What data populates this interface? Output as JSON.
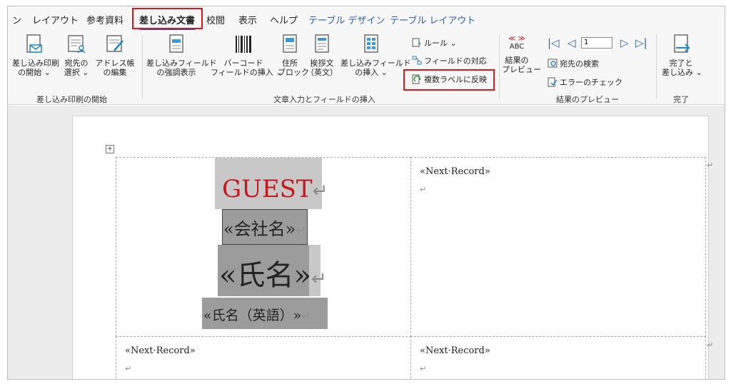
{
  "tabs": [
    {
      "label": "ン"
    },
    {
      "label": "レイアウト"
    },
    {
      "label": "参考資料"
    },
    {
      "label": "差し込み文書"
    },
    {
      "label": "校閲"
    },
    {
      "label": "表示"
    },
    {
      "label": "ヘルプ"
    },
    {
      "label": "テーブル デザイン"
    },
    {
      "label": "テーブル レイアウト"
    }
  ],
  "ribbon": {
    "start": {
      "merge_start": {
        "line1": "差し込み印刷",
        "line2": "の開始 ⌄"
      },
      "recipients": {
        "line1": "宛先の",
        "line2": "選択 ⌄"
      },
      "address_edit": {
        "line1": "アドレス帳",
        "line2": "の編集"
      },
      "group_label": "差し込み印刷の開始"
    },
    "insert": {
      "highlight": {
        "line1": "差し込みフィールド",
        "line2": "の強調表示"
      },
      "barcode": {
        "line1": "バーコード",
        "line2": "フィールドの挿入 ⌄"
      },
      "address_block": {
        "line1": "住所",
        "line2": "ブロック"
      },
      "greeting": {
        "line1": "挨拶文",
        "line2": "（英文）"
      },
      "merge_field": {
        "line1": "差し込みフィールド",
        "line2": "の挿入 ⌄"
      },
      "rules": "ルール ⌄",
      "match_fields": "フィールドの対応",
      "update_labels": "複数ラベルに反映",
      "group_label": "文章入力とフィールドの挿入"
    },
    "preview": {
      "abc_top": "≪ ≫",
      "abc_bottom": "ABC",
      "preview_results": {
        "line1": "結果の",
        "line2": "プレビュー"
      },
      "record_number": "1",
      "find_recipient": "宛先の検索",
      "check_errors": "エラーのチェック",
      "group_label": "結果のプレビュー"
    },
    "finish": {
      "finish_merge": {
        "line1": "完了と",
        "line2": "差し込み ⌄"
      },
      "group_label": "完了"
    }
  },
  "document": {
    "label1": {
      "guest": "GUEST",
      "company": "«会社名»",
      "name": "«氏名»",
      "name_en": "«氏名（英語）»"
    },
    "next_record": "«Next·Record»",
    "para_mark": "↵"
  },
  "colors": {
    "accent": "#185abd",
    "highlight_box": "#e0161b",
    "guest_red": "#c8161d",
    "field_gray": "#c8c8c8",
    "field_dark": "#9c9c9c"
  }
}
